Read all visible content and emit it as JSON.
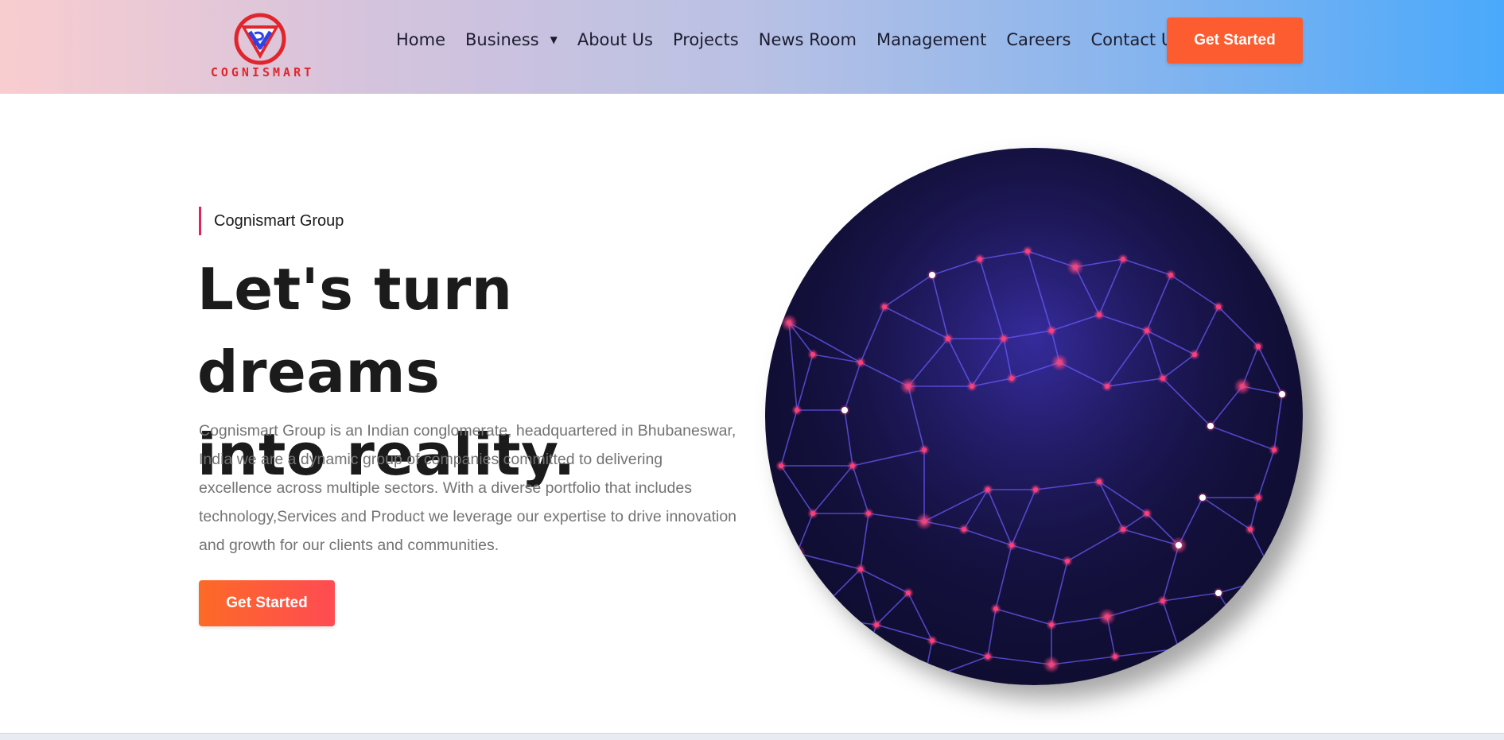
{
  "brand": {
    "name": "COGNISMART",
    "colors": {
      "accent": "#fd5c30",
      "logo_red": "#e1252d",
      "logo_blue": "#2d43e8",
      "eyebrow_bar": "#e0245e"
    }
  },
  "nav": {
    "items": [
      {
        "label": "Home"
      },
      {
        "label": "Business",
        "has_dropdown": true
      },
      {
        "label": "About Us"
      },
      {
        "label": "Projects"
      },
      {
        "label": "News Room"
      },
      {
        "label": "Management"
      },
      {
        "label": "Careers"
      },
      {
        "label": "Contact Us"
      }
    ],
    "cta_label": "Get Started"
  },
  "hero": {
    "eyebrow": "Cognismart Group",
    "headline_line1": "Let's turn dreams",
    "headline_line2": "into reality.",
    "description": "Cognismart Group is an Indian conglomerate, headquartered in Bhubaneswar, India we are a dynamic group of companies committed to delivering excellence across multiple sectors. With a diverse portfolio that includes technology,Services and Product we leverage our expertise to drive innovation and growth for our clients and communities.",
    "cta_label": "Get Started",
    "image_icon": "network-mesh-image"
  }
}
